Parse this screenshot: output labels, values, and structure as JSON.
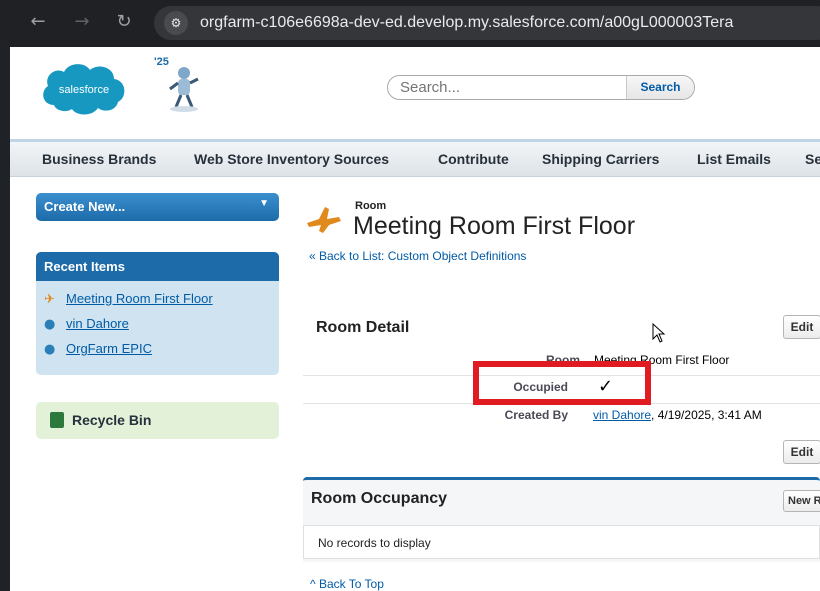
{
  "browser": {
    "url": "orgfarm-c106e6698a-dev-ed.develop.my.salesforce.com/a00gL000003Tera"
  },
  "header": {
    "logo_text": "salesforce",
    "release_badge": "'25",
    "search": {
      "placeholder": "Search...",
      "button_label": "Search"
    }
  },
  "tabs": [
    "Business Brands",
    "Web Store Inventory Sources",
    "Contribute",
    "Shipping Carriers",
    "List Emails",
    "Se"
  ],
  "sidebar": {
    "create_new_label": "Create New...",
    "recent_items_title": "Recent Items",
    "recent_items": [
      {
        "label": "Meeting Room First Floor",
        "icon": "room-icon"
      },
      {
        "label": "vin Dahore",
        "icon": "user-icon"
      },
      {
        "label": "OrgFarm EPIC",
        "icon": "user-icon"
      }
    ],
    "recycle_bin_label": "Recycle Bin"
  },
  "record": {
    "object_label": "Room",
    "title": "Meeting Room First Floor",
    "back_link": "« Back to List: Custom Object Definitions"
  },
  "detail": {
    "section_title": "Room Detail",
    "edit_label": "Edit",
    "fields": {
      "room_label": "Room",
      "room_value": "Meeting Room First Floor",
      "occupied_label": "Occupied",
      "occupied_value": "✓",
      "created_by_label": "Created By",
      "created_by_user": "vin Dahore",
      "created_by_date": ", 4/19/2025, 3:41 AM"
    }
  },
  "related": {
    "title": "Room Occupancy",
    "new_button_label": "New R",
    "empty_text": "No records to display"
  },
  "back_to_top": "^ Back To Top",
  "colors": {
    "accent_blue": "#1d6ba9",
    "link_blue": "#015ba7",
    "highlight_red": "#e11b22",
    "sidebar_bg": "#cfe4f0",
    "recycle_bg": "#e2f1d8"
  }
}
